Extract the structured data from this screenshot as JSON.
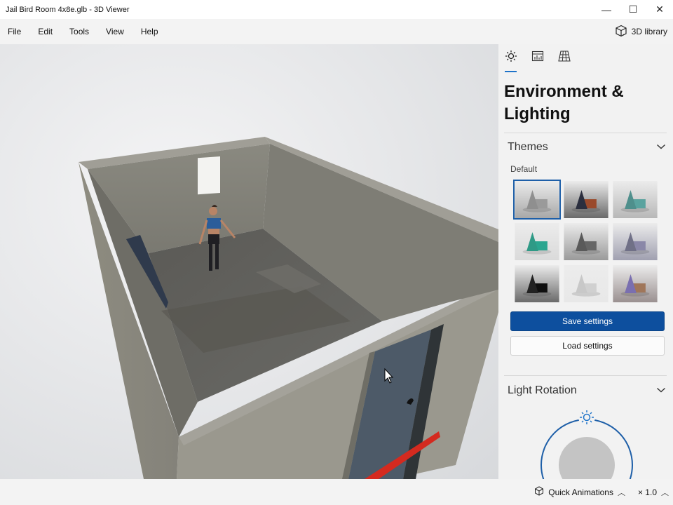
{
  "window": {
    "title": "Jail Bird Room  4x8e.glb - 3D Viewer",
    "controls": {
      "minimize": "—",
      "maximize": "☐",
      "close": "✕"
    }
  },
  "menu": {
    "items": [
      "File",
      "Edit",
      "Tools",
      "View",
      "Help"
    ],
    "library_label": "3D library",
    "library_icon": "cube-icon"
  },
  "panel": {
    "tabs": [
      {
        "name": "tab-environment-lighting",
        "icon": "sun-icon",
        "active": true
      },
      {
        "name": "tab-stats",
        "icon": "stats-icon",
        "active": false
      },
      {
        "name": "tab-grid",
        "icon": "grid-icon",
        "active": false
      }
    ],
    "title": "Environment & Lighting",
    "themes": {
      "header": "Themes",
      "sublabel": "Default",
      "items": [
        {
          "name": "theme-default-gray",
          "colors": [
            "#8f8f8f",
            "#9a9a9a",
            "#a8a8a8"
          ],
          "selected": true
        },
        {
          "name": "theme-dark-orange",
          "colors": [
            "#2b2f3f",
            "#9a4a2c",
            "#6a6a6a"
          ],
          "selected": false
        },
        {
          "name": "theme-teal",
          "colors": [
            "#4f8f8c",
            "#5aa39f",
            "#b8b8b8"
          ],
          "selected": false
        },
        {
          "name": "theme-green",
          "colors": [
            "#2f9a86",
            "#2ba690",
            "#dadada"
          ],
          "selected": false
        },
        {
          "name": "theme-charcoal",
          "colors": [
            "#5a5a5a",
            "#666666",
            "#9a9a9a"
          ],
          "selected": false
        },
        {
          "name": "theme-lavender",
          "colors": [
            "#707087",
            "#8a87a8",
            "#a0a0b0"
          ],
          "selected": false
        },
        {
          "name": "theme-black",
          "colors": [
            "#222222",
            "#0f0f0f",
            "#6a6a6a"
          ],
          "selected": false
        },
        {
          "name": "theme-light",
          "colors": [
            "#c8c8c8",
            "#d0d0d0",
            "#e8e8e8"
          ],
          "selected": false
        },
        {
          "name": "theme-purple-copper",
          "colors": [
            "#7a6fb0",
            "#a0765a",
            "#9a9090"
          ],
          "selected": false
        }
      ]
    },
    "save_label": "Save settings",
    "load_label": "Load settings",
    "light_rotation": {
      "header": "Light Rotation"
    }
  },
  "status": {
    "animations_label": "Quick Animations",
    "speed_label": "× 1.0"
  },
  "colors": {
    "accent": "#1e73c9",
    "primary_button": "#0d4f9e"
  }
}
